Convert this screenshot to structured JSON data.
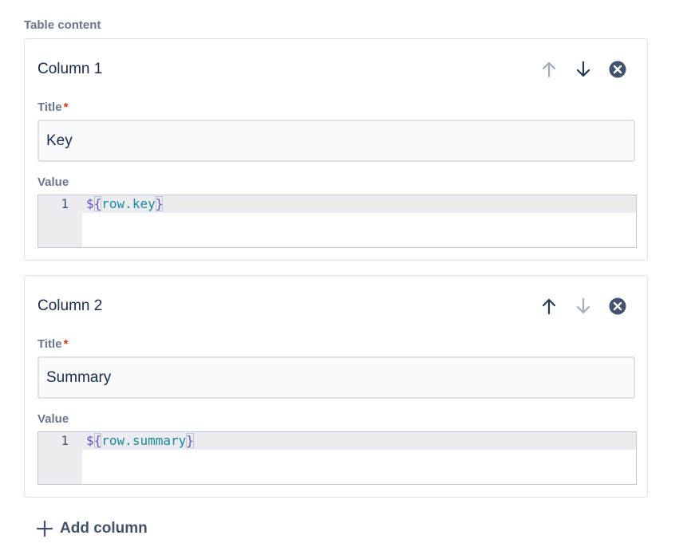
{
  "section": {
    "label": "Table content"
  },
  "columns": [
    {
      "heading": "Column 1",
      "title_label": "Title",
      "required_marker": "*",
      "title_value": "Key",
      "value_label": "Value",
      "line_number": "1",
      "code": {
        "dollar": "$",
        "open": "{",
        "expr": "row.key",
        "close": "}"
      },
      "move_up_enabled": false,
      "move_down_enabled": true,
      "icons": [
        "arrow-up-icon",
        "arrow-down-icon",
        "remove-circle-icon"
      ]
    },
    {
      "heading": "Column 2",
      "title_label": "Title",
      "required_marker": "*",
      "title_value": "Summary",
      "value_label": "Value",
      "line_number": "1",
      "code": {
        "dollar": "$",
        "open": "{",
        "expr": "row.summary",
        "close": "}"
      },
      "move_up_enabled": true,
      "move_down_enabled": false,
      "icons": [
        "arrow-up-icon",
        "arrow-down-icon",
        "remove-circle-icon"
      ]
    }
  ],
  "add_column": {
    "label": "Add column",
    "icon": "plus-icon"
  },
  "colors": {
    "text_primary": "#172b4d",
    "text_secondary": "#6b778c",
    "required": "#de350b",
    "icon_enabled": "#253858",
    "icon_disabled": "#a5adba",
    "template_token": "#6554c0",
    "template_expr": "#1b8a9c"
  }
}
